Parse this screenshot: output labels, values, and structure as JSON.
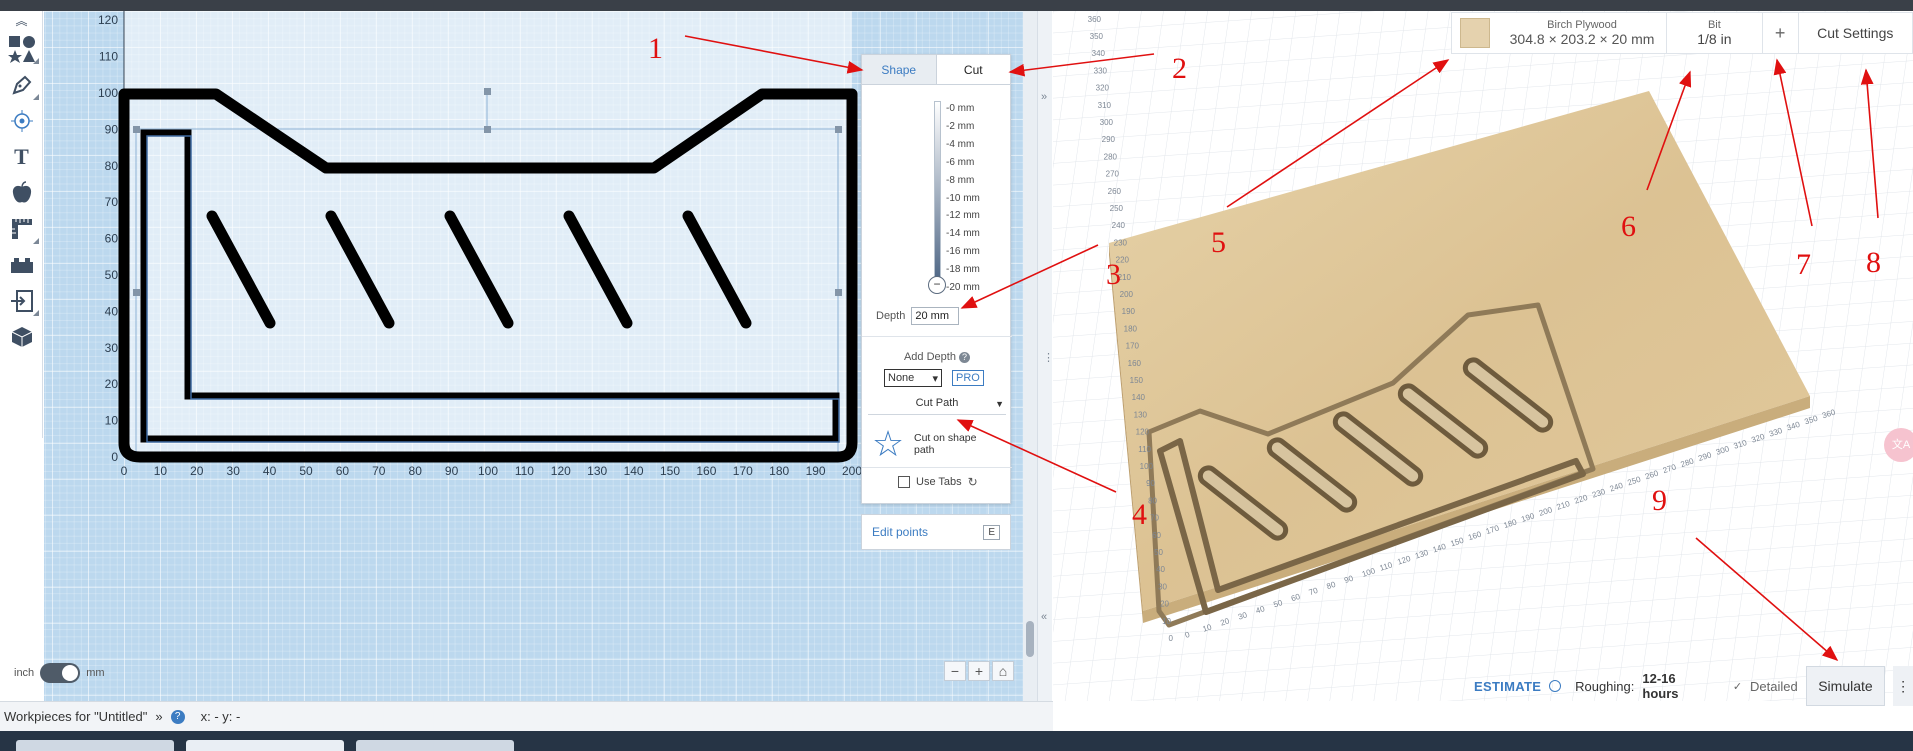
{
  "toolbar": {
    "tools": [
      {
        "name": "collapse-icon",
        "glyph": "︽"
      },
      {
        "name": "shapes-icon",
        "glyph": "■●★▲"
      },
      {
        "name": "pen-icon",
        "glyph": "✒"
      },
      {
        "name": "point-icon",
        "glyph": "⊙"
      },
      {
        "name": "text-icon",
        "glyph": "T"
      },
      {
        "name": "apple-icon",
        "glyph": "●"
      },
      {
        "name": "ruler-icon",
        "glyph": "📏"
      },
      {
        "name": "brick-icon",
        "glyph": "▬"
      },
      {
        "name": "import-icon",
        "glyph": "⇥"
      },
      {
        "name": "box-3d-icon",
        "glyph": "⬢"
      }
    ]
  },
  "canvas": {
    "y_ticks": [
      "120",
      "110",
      "100",
      "90",
      "80",
      "70",
      "60",
      "50",
      "40",
      "30",
      "20",
      "10",
      "0"
    ],
    "x_ticks": [
      "0",
      "10",
      "20",
      "30",
      "40",
      "50",
      "60",
      "70",
      "80",
      "90",
      "100",
      "110",
      "120",
      "130",
      "140",
      "150",
      "160",
      "170",
      "180",
      "190",
      "200"
    ],
    "x_tick_partial": "2"
  },
  "panel": {
    "tab_shape": "Shape",
    "tab_cut": "Cut",
    "depth_ticks": [
      "-0 mm",
      "-2 mm",
      "-4 mm",
      "-6 mm",
      "-8 mm",
      "-10 mm",
      "-12 mm",
      "-14 mm",
      "-16 mm",
      "-18 mm",
      "-20 mm"
    ],
    "depth_label": "Depth",
    "depth_value": "20 mm",
    "add_depth_label": "Add Depth",
    "add_depth_help": "?",
    "add_depth_select": "None",
    "pro_label": "PRO",
    "cut_path_label": "Cut Path",
    "cut_path_option": "Cut on shape path",
    "use_tabs_label": "Use Tabs",
    "edit_points_label": "Edit points",
    "edit_points_key": "E"
  },
  "zoom": {
    "minus": "−",
    "plus": "+",
    "home": "⌂"
  },
  "units": {
    "left": "inch",
    "right": "mm"
  },
  "status": {
    "workpieces_label": "Workpieces for \"Untitled\"",
    "help": "?",
    "coords": "x: - y: -"
  },
  "preview": {
    "material_name": "Birch Plywood",
    "material_dims": "304.8 × 203.2 × 20 mm",
    "bit_label": "Bit",
    "bit_value": "1/8 in",
    "add_label": "+",
    "cut_settings_label": "Cut Settings",
    "estimate_label": "ESTIMATE",
    "roughing_label": "Roughing:",
    "roughing_value": "12-16 hours",
    "detailed_label": "Detailed",
    "simulate_label": "Simulate",
    "more_label": "⋮",
    "translate_label": "文A",
    "bottom_axis_ticks": [
      "0",
      "10",
      "20",
      "30",
      "40",
      "50",
      "60",
      "70",
      "80",
      "90",
      "100",
      "110",
      "120",
      "130",
      "140",
      "150",
      "160",
      "170",
      "180",
      "190",
      "200",
      "210",
      "220",
      "230",
      "240",
      "250",
      "260",
      "270",
      "280",
      "290",
      "300",
      "310",
      "320",
      "330",
      "340",
      "350",
      "360"
    ],
    "left_axis_ticks": [
      "0",
      "10",
      "20",
      "30",
      "40",
      "50",
      "60",
      "70",
      "80",
      "90",
      "100",
      "110",
      "120",
      "130",
      "140",
      "150",
      "160",
      "170",
      "180",
      "190",
      "200",
      "210",
      "220",
      "230",
      "240",
      "250",
      "260",
      "270",
      "280",
      "290",
      "300",
      "310",
      "320",
      "330",
      "340",
      "350",
      "360"
    ]
  },
  "annotations": [
    "1",
    "2",
    "3",
    "4",
    "5",
    "6",
    "7",
    "8",
    "9"
  ],
  "colors": {
    "accent": "#3c7cc2",
    "annotation": "#e01010",
    "canvas_bg": "#bcd8ee",
    "wood": "#e2cc9f"
  }
}
